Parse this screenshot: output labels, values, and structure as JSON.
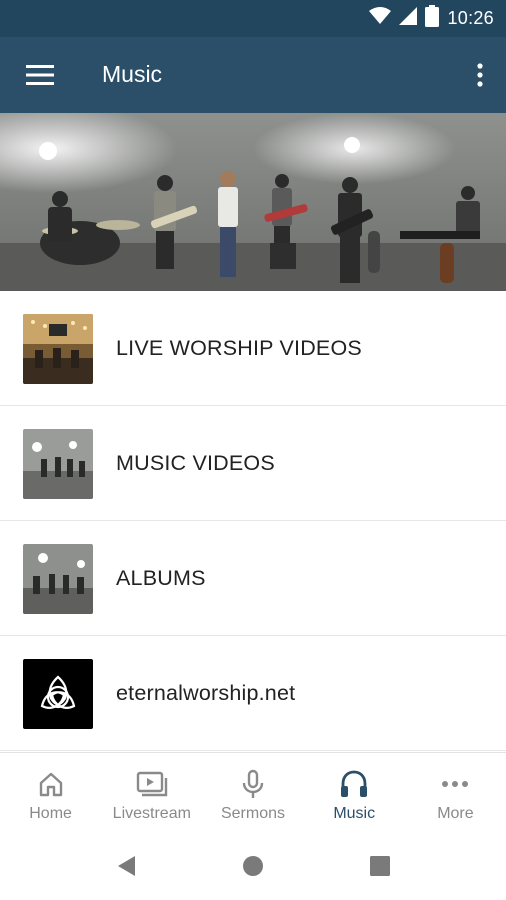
{
  "status_bar": {
    "time": "10:26",
    "icons": [
      "wifi-icon",
      "cell-signal-icon",
      "battery-icon"
    ]
  },
  "app_bar": {
    "title": "Music",
    "menu_icon": "hamburger-menu-icon",
    "overflow_icon": "more-vert-icon"
  },
  "hero": {
    "alt": "Band performing in studio"
  },
  "list": [
    {
      "label": "LIVE WORSHIP VIDEOS",
      "thumb": "live-worship-thumb"
    },
    {
      "label": "MUSIC VIDEOS",
      "thumb": "music-videos-thumb"
    },
    {
      "label": "ALBUMS",
      "thumb": "albums-thumb"
    },
    {
      "label": "eternalworship.net",
      "thumb": "trinity-knot-logo"
    }
  ],
  "bottom_nav": [
    {
      "label": "Home",
      "icon": "home-icon",
      "active": false
    },
    {
      "label": "Livestream",
      "icon": "livestream-icon",
      "active": false
    },
    {
      "label": "Sermons",
      "icon": "microphone-icon",
      "active": false
    },
    {
      "label": "Music",
      "icon": "headphones-icon",
      "active": true
    },
    {
      "label": "More",
      "icon": "more-horiz-icon",
      "active": false
    }
  ],
  "colors": {
    "app_bar": "#2b4f69",
    "status_bar": "#23465f",
    "active_tab": "#2b4f69",
    "inactive_tab": "#8a8a8a"
  }
}
